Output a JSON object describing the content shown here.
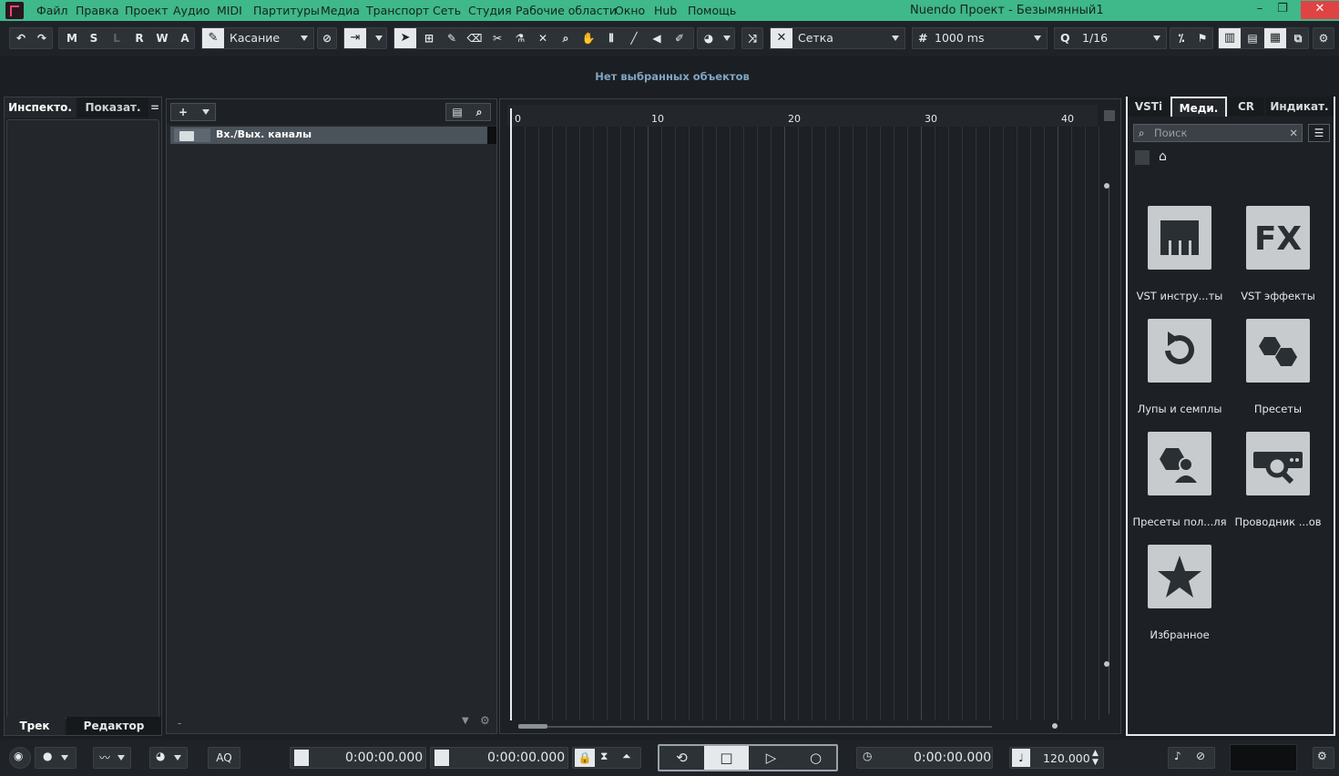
{
  "app": {
    "title": "Nuendo Проект - Безымянный1",
    "accent": "#3fb88a",
    "close_color": "#e04343"
  },
  "menu": [
    "Файл",
    "Правка",
    "Проект",
    "Аудио",
    "MIDI",
    "Партитуры",
    "Медиа",
    "Транспорт",
    "Сеть",
    "Студия",
    "Рабочие области",
    "Окно",
    "Hub",
    "Помощь"
  ],
  "window_controls": {
    "minimize": "–",
    "restore": "❐",
    "close": "✕"
  },
  "toolbar": {
    "undo_icon": "undo-icon",
    "redo_icon": "redo-icon",
    "msrwa": [
      "M",
      "S",
      "L",
      "R",
      "W",
      "A"
    ],
    "automation_mode": "Касание",
    "snap_type": "Сетка",
    "grid_value": "1000 ms",
    "quantize_value": "1/16"
  },
  "info_line": {
    "text": "Нет выбранных объектов"
  },
  "left_zone": {
    "tabs": [
      "Инспекто.",
      "Показат.",
      "="
    ],
    "bottom_tabs": [
      "Трек",
      "Редактор"
    ]
  },
  "track_list": {
    "add_label": "+",
    "tracks": [
      {
        "name": "Вх./Вых. каналы"
      }
    ],
    "footer_minus": "-"
  },
  "ruler": {
    "labels": [
      "0",
      "10",
      "20",
      "30",
      "40"
    ]
  },
  "right_zone": {
    "tabs": [
      "VSTi",
      "Меди.",
      "CR",
      "Индикат."
    ],
    "search_placeholder": "Поиск",
    "tiles": [
      {
        "label": "VST инстру...ты",
        "icon": "piano-keys-icon"
      },
      {
        "label": "VST эффекты",
        "icon": "fx-icon"
      },
      {
        "label": "Лупы и семплы",
        "icon": "loop-icon"
      },
      {
        "label": "Пресеты",
        "icon": "hexagons-icon"
      },
      {
        "label": "Пресеты пол...ля",
        "icon": "user-preset-icon"
      },
      {
        "label": "Проводник ...ов",
        "icon": "browser-icon"
      },
      {
        "label": "Избранное",
        "icon": "star-icon"
      }
    ]
  },
  "transport": {
    "left_locator": "0:00:00.000",
    "right_locator": "0:00:00.000",
    "position": "0:00:00.000",
    "tempo": "120.000",
    "aq_label": "AQ"
  }
}
